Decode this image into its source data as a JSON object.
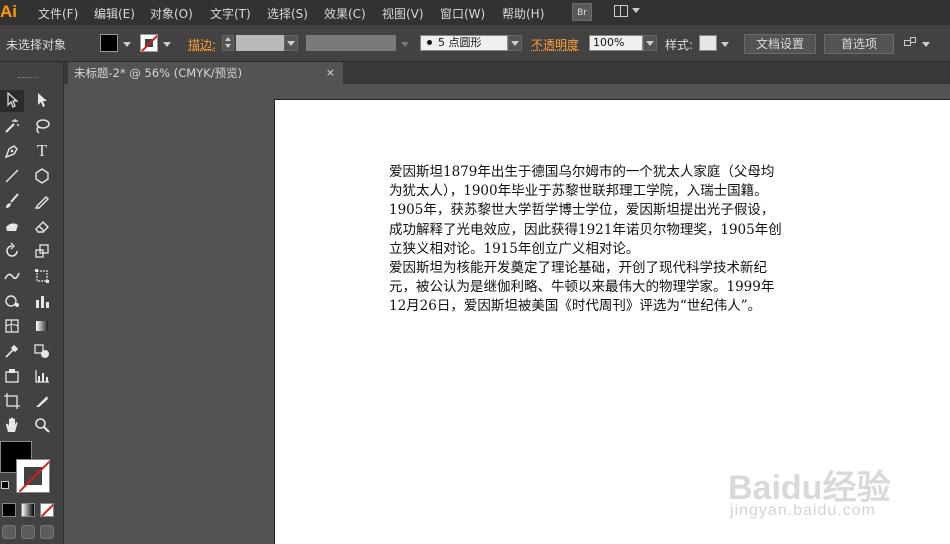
{
  "app": {
    "logo": "Ai",
    "menu": [
      "文件(F)",
      "编辑(E)",
      "对象(O)",
      "文字(T)",
      "选择(S)",
      "效果(C)",
      "视图(V)",
      "窗口(W)",
      "帮助(H)"
    ],
    "bridge_label": "Br"
  },
  "control_bar": {
    "selection_status": "未选择对象",
    "stroke_label": "描边:",
    "brush_value": "5 点圆形",
    "opacity_label": "不透明度",
    "opacity_value": "100%",
    "style_label": "样式:",
    "doc_setup_button": "文档设置",
    "preferences_button": "首选项",
    "colors": {
      "fill": "#000000",
      "stroke_none": "#e01b1b",
      "label_accent": "#ff9c35"
    }
  },
  "document": {
    "tab_title": "未标题-2* @ 56% (CMYK/预览)",
    "close_glyph": "×"
  },
  "artboard_text": {
    "lines": [
      "爱因斯坦1879年出生于德国乌尔姆市的一个犹太人家庭（父母均",
      "为犹太人），1900年毕业于苏黎世联邦理工学院，入瑞士国籍。",
      "1905年，获苏黎世大学哲学博士学位，爱因斯坦提出光子假设，",
      "成功解释了光电效应，因此获得1921年诺贝尔物理奖，1905年创",
      "立狭义相对论。1915年创立广义相对论。",
      "爱因斯坦为核能开发奠定了理论基础，开创了现代科学技术新纪",
      "元，被公认为是继伽利略、牛顿以来最伟大的物理学家。1999年",
      "12月26日，爱因斯坦被美国《时代周刊》评选为“世纪伟人”。"
    ]
  },
  "tools": [
    "selection-tool",
    "direct-selection-tool",
    "magic-wand-tool",
    "lasso-tool",
    "pen-tool",
    "type-tool",
    "line-tool",
    "shape-tool",
    "paintbrush-tool",
    "pencil-tool",
    "blob-brush-tool",
    "eraser-tool",
    "rotate-tool",
    "scale-tool",
    "warp-tool",
    "free-transform-tool",
    "symbol-sprayer-tool",
    "column-graph-tool",
    "mesh-tool",
    "gradient-tool",
    "eyedropper-tool",
    "blend-tool",
    "slice-tool",
    "graph-tool",
    "artboard-tool",
    "knife-tool",
    "hand-tool",
    "zoom-tool"
  ],
  "watermark": {
    "brand": "Baidu经验",
    "url": "jingyan.baidu.com"
  }
}
